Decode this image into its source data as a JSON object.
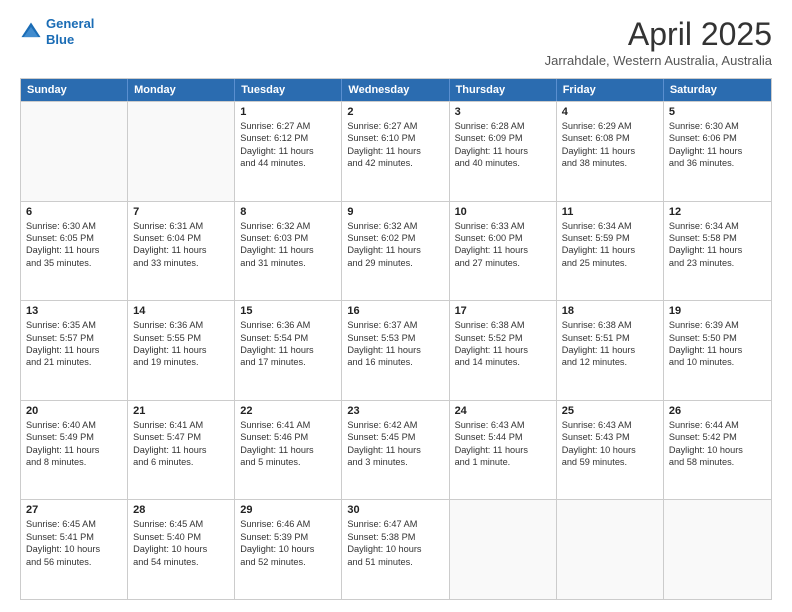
{
  "logo": {
    "line1": "General",
    "line2": "Blue"
  },
  "title": "April 2025",
  "location": "Jarrahdale, Western Australia, Australia",
  "headers": [
    "Sunday",
    "Monday",
    "Tuesday",
    "Wednesday",
    "Thursday",
    "Friday",
    "Saturday"
  ],
  "rows": [
    [
      {
        "day": "",
        "lines": []
      },
      {
        "day": "",
        "lines": []
      },
      {
        "day": "1",
        "lines": [
          "Sunrise: 6:27 AM",
          "Sunset: 6:12 PM",
          "Daylight: 11 hours",
          "and 44 minutes."
        ]
      },
      {
        "day": "2",
        "lines": [
          "Sunrise: 6:27 AM",
          "Sunset: 6:10 PM",
          "Daylight: 11 hours",
          "and 42 minutes."
        ]
      },
      {
        "day": "3",
        "lines": [
          "Sunrise: 6:28 AM",
          "Sunset: 6:09 PM",
          "Daylight: 11 hours",
          "and 40 minutes."
        ]
      },
      {
        "day": "4",
        "lines": [
          "Sunrise: 6:29 AM",
          "Sunset: 6:08 PM",
          "Daylight: 11 hours",
          "and 38 minutes."
        ]
      },
      {
        "day": "5",
        "lines": [
          "Sunrise: 6:30 AM",
          "Sunset: 6:06 PM",
          "Daylight: 11 hours",
          "and 36 minutes."
        ]
      }
    ],
    [
      {
        "day": "6",
        "lines": [
          "Sunrise: 6:30 AM",
          "Sunset: 6:05 PM",
          "Daylight: 11 hours",
          "and 35 minutes."
        ]
      },
      {
        "day": "7",
        "lines": [
          "Sunrise: 6:31 AM",
          "Sunset: 6:04 PM",
          "Daylight: 11 hours",
          "and 33 minutes."
        ]
      },
      {
        "day": "8",
        "lines": [
          "Sunrise: 6:32 AM",
          "Sunset: 6:03 PM",
          "Daylight: 11 hours",
          "and 31 minutes."
        ]
      },
      {
        "day": "9",
        "lines": [
          "Sunrise: 6:32 AM",
          "Sunset: 6:02 PM",
          "Daylight: 11 hours",
          "and 29 minutes."
        ]
      },
      {
        "day": "10",
        "lines": [
          "Sunrise: 6:33 AM",
          "Sunset: 6:00 PM",
          "Daylight: 11 hours",
          "and 27 minutes."
        ]
      },
      {
        "day": "11",
        "lines": [
          "Sunrise: 6:34 AM",
          "Sunset: 5:59 PM",
          "Daylight: 11 hours",
          "and 25 minutes."
        ]
      },
      {
        "day": "12",
        "lines": [
          "Sunrise: 6:34 AM",
          "Sunset: 5:58 PM",
          "Daylight: 11 hours",
          "and 23 minutes."
        ]
      }
    ],
    [
      {
        "day": "13",
        "lines": [
          "Sunrise: 6:35 AM",
          "Sunset: 5:57 PM",
          "Daylight: 11 hours",
          "and 21 minutes."
        ]
      },
      {
        "day": "14",
        "lines": [
          "Sunrise: 6:36 AM",
          "Sunset: 5:55 PM",
          "Daylight: 11 hours",
          "and 19 minutes."
        ]
      },
      {
        "day": "15",
        "lines": [
          "Sunrise: 6:36 AM",
          "Sunset: 5:54 PM",
          "Daylight: 11 hours",
          "and 17 minutes."
        ]
      },
      {
        "day": "16",
        "lines": [
          "Sunrise: 6:37 AM",
          "Sunset: 5:53 PM",
          "Daylight: 11 hours",
          "and 16 minutes."
        ]
      },
      {
        "day": "17",
        "lines": [
          "Sunrise: 6:38 AM",
          "Sunset: 5:52 PM",
          "Daylight: 11 hours",
          "and 14 minutes."
        ]
      },
      {
        "day": "18",
        "lines": [
          "Sunrise: 6:38 AM",
          "Sunset: 5:51 PM",
          "Daylight: 11 hours",
          "and 12 minutes."
        ]
      },
      {
        "day": "19",
        "lines": [
          "Sunrise: 6:39 AM",
          "Sunset: 5:50 PM",
          "Daylight: 11 hours",
          "and 10 minutes."
        ]
      }
    ],
    [
      {
        "day": "20",
        "lines": [
          "Sunrise: 6:40 AM",
          "Sunset: 5:49 PM",
          "Daylight: 11 hours",
          "and 8 minutes."
        ]
      },
      {
        "day": "21",
        "lines": [
          "Sunrise: 6:41 AM",
          "Sunset: 5:47 PM",
          "Daylight: 11 hours",
          "and 6 minutes."
        ]
      },
      {
        "day": "22",
        "lines": [
          "Sunrise: 6:41 AM",
          "Sunset: 5:46 PM",
          "Daylight: 11 hours",
          "and 5 minutes."
        ]
      },
      {
        "day": "23",
        "lines": [
          "Sunrise: 6:42 AM",
          "Sunset: 5:45 PM",
          "Daylight: 11 hours",
          "and 3 minutes."
        ]
      },
      {
        "day": "24",
        "lines": [
          "Sunrise: 6:43 AM",
          "Sunset: 5:44 PM",
          "Daylight: 11 hours",
          "and 1 minute."
        ]
      },
      {
        "day": "25",
        "lines": [
          "Sunrise: 6:43 AM",
          "Sunset: 5:43 PM",
          "Daylight: 10 hours",
          "and 59 minutes."
        ]
      },
      {
        "day": "26",
        "lines": [
          "Sunrise: 6:44 AM",
          "Sunset: 5:42 PM",
          "Daylight: 10 hours",
          "and 58 minutes."
        ]
      }
    ],
    [
      {
        "day": "27",
        "lines": [
          "Sunrise: 6:45 AM",
          "Sunset: 5:41 PM",
          "Daylight: 10 hours",
          "and 56 minutes."
        ]
      },
      {
        "day": "28",
        "lines": [
          "Sunrise: 6:45 AM",
          "Sunset: 5:40 PM",
          "Daylight: 10 hours",
          "and 54 minutes."
        ]
      },
      {
        "day": "29",
        "lines": [
          "Sunrise: 6:46 AM",
          "Sunset: 5:39 PM",
          "Daylight: 10 hours",
          "and 52 minutes."
        ]
      },
      {
        "day": "30",
        "lines": [
          "Sunrise: 6:47 AM",
          "Sunset: 5:38 PM",
          "Daylight: 10 hours",
          "and 51 minutes."
        ]
      },
      {
        "day": "",
        "lines": []
      },
      {
        "day": "",
        "lines": []
      },
      {
        "day": "",
        "lines": []
      }
    ]
  ]
}
